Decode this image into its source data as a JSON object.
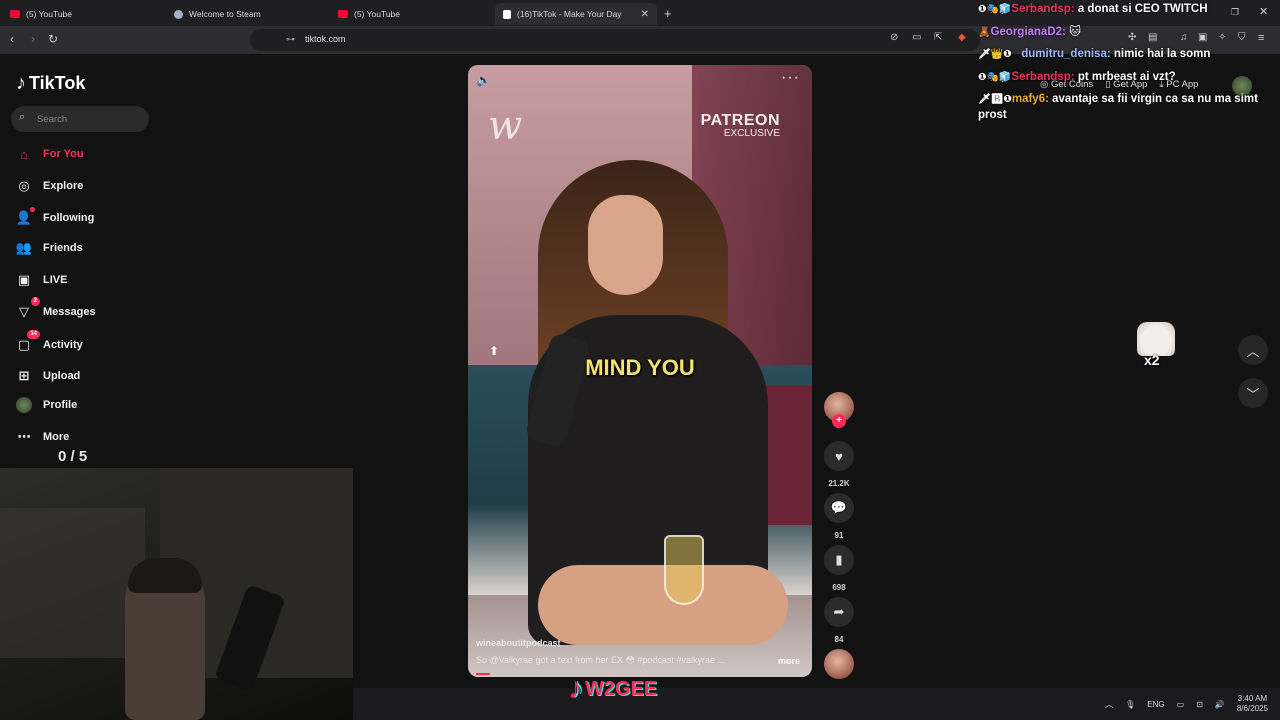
{
  "browser": {
    "tabs": [
      {
        "title": "(5) YouTube",
        "color": "#ff0033"
      },
      {
        "title": "Welcome to Steam",
        "color": "#9fb3c8"
      },
      {
        "title": "(5) YouTube",
        "color": "#ff0033"
      },
      {
        "title": "(16)TikTok - Make Your Day",
        "color": "#ffffff"
      }
    ],
    "new_tab": "+",
    "url": "tiktok.com"
  },
  "sidebar": {
    "logo": "TikTok",
    "search_placeholder": "Search",
    "items": [
      {
        "label": "For You",
        "icon": "home-icon",
        "active": true
      },
      {
        "label": "Explore",
        "icon": "compass-icon"
      },
      {
        "label": "Following",
        "icon": "person-icon"
      },
      {
        "label": "Friends",
        "icon": "friends-icon"
      },
      {
        "label": "LIVE",
        "icon": "live-icon"
      },
      {
        "label": "Messages",
        "icon": "send-icon",
        "badge": "2"
      },
      {
        "label": "Activity",
        "icon": "inbox-icon",
        "badge": "14"
      },
      {
        "label": "Upload",
        "icon": "plus-square-icon"
      },
      {
        "label": "Profile",
        "icon": "avatar-icon"
      },
      {
        "label": "More",
        "icon": "dots-icon"
      }
    ],
    "counter": "0  / 5"
  },
  "video": {
    "brand_top": "PATREON",
    "brand_bottom": "EXCLUSIVE",
    "caption": "MIND YOU",
    "author": "wineaboutitpodcast",
    "description": "So @Valkyrae  got a text from her EX 😳 #podcast  #valkyrae  ...",
    "more": "more"
  },
  "actions": {
    "likes": "21.2K",
    "comments": "91",
    "saves": "698",
    "shares": "84"
  },
  "overlay": {
    "get_coins": "Get Coins",
    "get_app": "Get App",
    "pc_app": "PC App",
    "multiplier": "x2"
  },
  "chat": [
    {
      "user": "Serbandsp:",
      "user_color": "#e8315a",
      "message": "a donat si CEO TWITCH"
    },
    {
      "user": "GeorgianaD2:",
      "user_color": "#c77dff",
      "message": "🐱"
    },
    {
      "user": "dumitru_denisa:",
      "user_color": "#9fb8ff",
      "message": "nimic hai la somn"
    },
    {
      "user": "Serbandsp:",
      "user_color": "#e8315a",
      "message": "pt mrbeast ai vzt?"
    },
    {
      "user": "mafy6:",
      "user_color": "#e9a93b",
      "message": "avantaje sa fii virgin ca sa nu ma simt prost"
    }
  ],
  "taskbar": {
    "brand": "W2GEE",
    "lang": "ENG",
    "time": "3:40 AM",
    "date": "8/6/2025"
  }
}
